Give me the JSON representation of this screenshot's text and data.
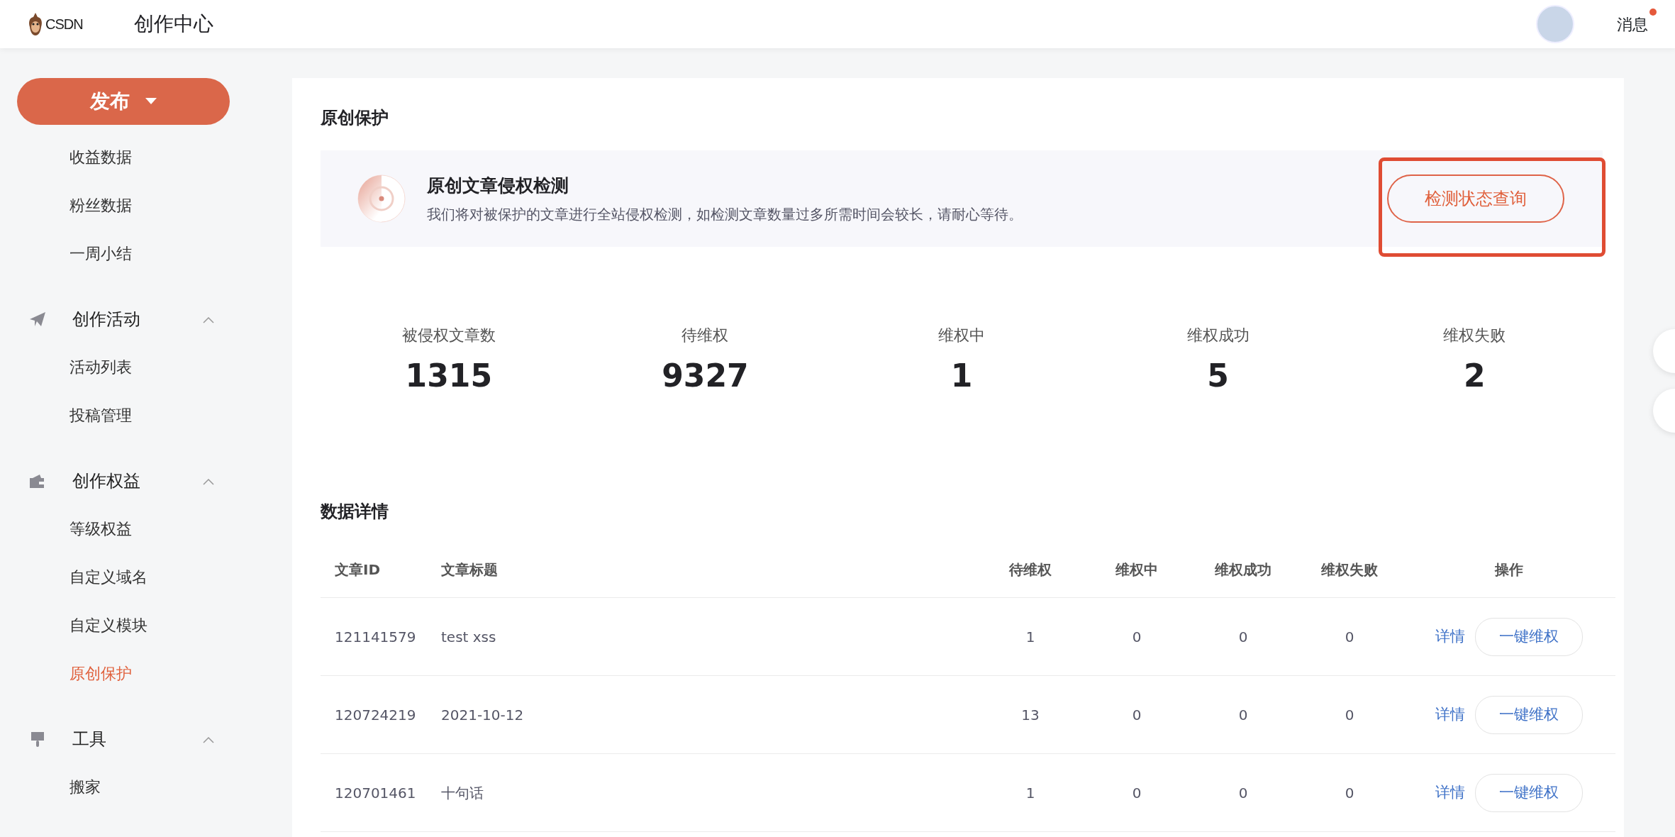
{
  "header": {
    "logo": "CSDN",
    "title": "创作中心",
    "messages": {
      "label": "消息",
      "unread": true
    }
  },
  "sidebar": {
    "publish": "发布",
    "groups": [
      {
        "items": [
          {
            "label": "收益数据",
            "selected": false
          },
          {
            "label": "粉丝数据",
            "selected": false
          },
          {
            "label": "一周小结",
            "selected": false
          }
        ]
      },
      {
        "label": "创作活动",
        "kind": "plane",
        "expanded": true,
        "items": [
          {
            "label": "活动列表",
            "selected": false
          },
          {
            "label": "投稿管理",
            "selected": false
          }
        ]
      },
      {
        "label": "创作权益",
        "kind": "wallet",
        "expanded": true,
        "items": [
          {
            "label": "等级权益",
            "selected": false
          },
          {
            "label": "自定义域名",
            "selected": false
          },
          {
            "label": "自定义模块",
            "selected": false
          },
          {
            "label": "原创保护",
            "selected": true
          }
        ]
      },
      {
        "label": "工具",
        "kind": "brush",
        "expanded": true,
        "items": [
          {
            "label": "搬家",
            "selected": false
          }
        ]
      }
    ]
  },
  "page": {
    "title": "原创保护",
    "banner": {
      "title": "原创文章侵权检测",
      "text": "我们将对被保护的文章进行全站侵权检测，如检测文章数量过多所需时间会较长，请耐心等待。",
      "button": "检测状态查询",
      "highlighted": true
    },
    "stats": [
      {
        "label": "被侵权文章数",
        "value": "1315"
      },
      {
        "label": "待维权",
        "value": "9327"
      },
      {
        "label": "维权中",
        "value": "1"
      },
      {
        "label": "维权成功",
        "value": "5"
      },
      {
        "label": "维权失败",
        "value": "2"
      }
    ],
    "details_title": "数据详情",
    "table": {
      "columns": [
        "文章ID",
        "文章标题",
        "待维权",
        "维权中",
        "维权成功",
        "维权失败",
        "操作"
      ],
      "rows": [
        {
          "id": "121141579",
          "title": "test xss",
          "pending": "1",
          "in_progress": "0",
          "success": "0",
          "failed": "0",
          "detail": "详情",
          "action": "一键维权"
        },
        {
          "id": "120724219",
          "title": "2021-10-12",
          "pending": "13",
          "in_progress": "0",
          "success": "0",
          "failed": "0",
          "detail": "详情",
          "action": "一键维权"
        },
        {
          "id": "120701461",
          "title": "十句话",
          "pending": "1",
          "in_progress": "0",
          "success": "0",
          "failed": "0",
          "detail": "详情",
          "action": "一键维权"
        }
      ]
    }
  }
}
